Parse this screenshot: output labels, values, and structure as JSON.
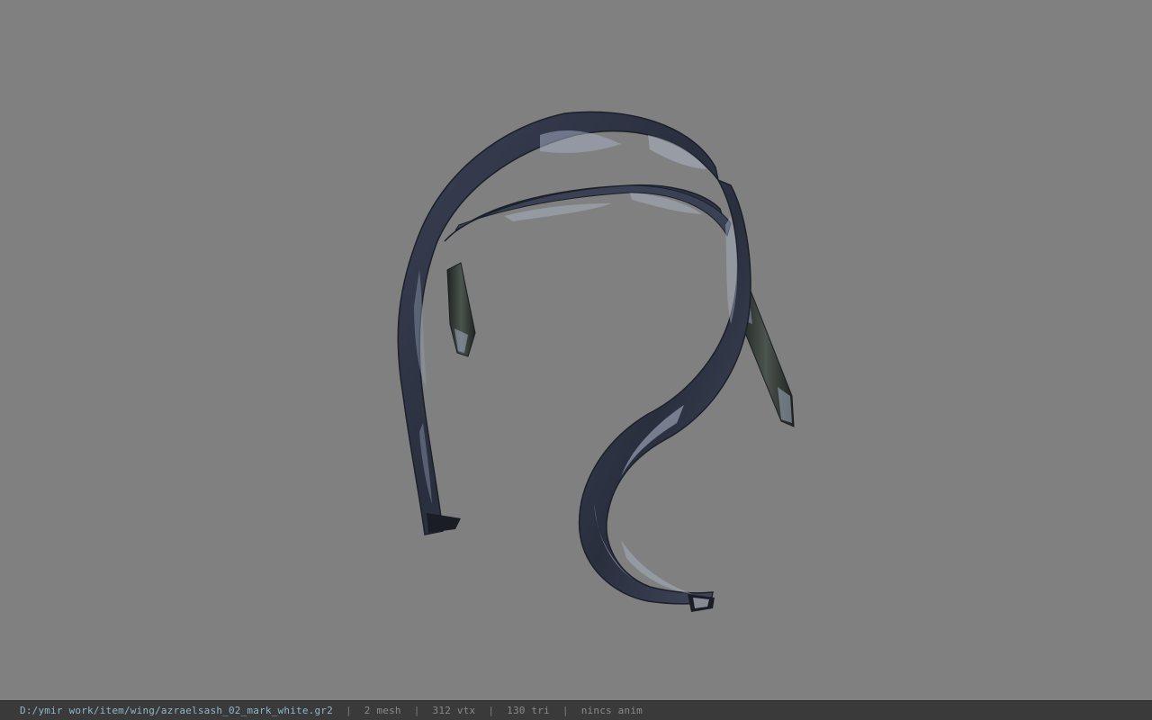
{
  "viewport": {
    "background": "#808080",
    "model_name": "azraelsash_02_mark_white"
  },
  "statusbar": {
    "file_path": "D:/ymir work/item/wing/azraelsash_02_mark_white.gr2",
    "separator": "|",
    "mesh_count": "2 mesh",
    "vertex_count": "312 vtx",
    "triangle_count": "130 tri",
    "anim_status": "nincs anim"
  },
  "colors": {
    "sash_dark": "#2b3040",
    "sash_mid": "#4a5266",
    "sash_light": "#a7b0c4",
    "path_text": "#8fb7c9"
  }
}
